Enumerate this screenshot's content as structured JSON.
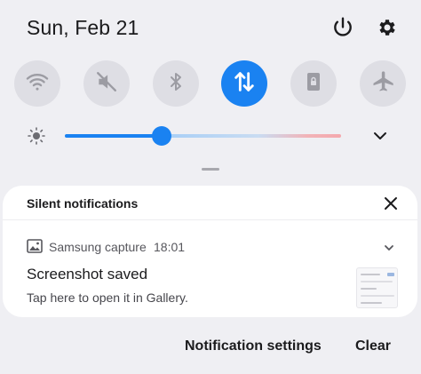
{
  "status": {
    "date": "Sun, Feb 21"
  },
  "quick_toggles": [
    {
      "icon": "wifi-icon",
      "active": false
    },
    {
      "icon": "sound-muted-icon",
      "active": false
    },
    {
      "icon": "bluetooth-icon",
      "active": false
    },
    {
      "icon": "mobile-data-icon",
      "active": true
    },
    {
      "icon": "portrait-lock-icon",
      "active": false
    },
    {
      "icon": "airplane-icon",
      "active": false
    }
  ],
  "brightness": {
    "level_percent": 35
  },
  "notifications": {
    "section_title": "Silent notifications",
    "items": [
      {
        "app": "Samsung capture",
        "time": "18:01",
        "title": "Screenshot saved",
        "text": "Tap here to open it in Gallery."
      }
    ]
  },
  "footer": {
    "settings_label": "Notification settings",
    "clear_label": "Clear"
  },
  "colors": {
    "accent": "#1a82f1",
    "background": "#efeff3",
    "toggle_inactive": "#dedee4",
    "card": "#ffffff"
  }
}
